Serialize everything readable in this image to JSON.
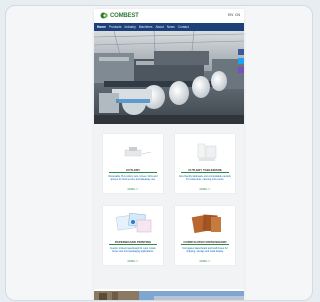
{
  "header": {
    "logo_text": "COMBEST",
    "lang": [
      "EN",
      "CN"
    ]
  },
  "nav": {
    "items": [
      "Home",
      "Products",
      "Industry",
      "Machines",
      "About",
      "News",
      "Contact"
    ]
  },
  "products": [
    {
      "title": "Cutlery",
      "desc": "Disposable PLA cutlery sets, knives, forks and spoons for food service and takeaway use.",
      "more": "MORE >>"
    },
    {
      "title": "Cutlery Tableware",
      "desc": "Eco-friendly tableware and compostable utensils for restaurants, catering and events.",
      "more": "MORE >>"
    },
    {
      "title": "Paperboard Printing",
      "desc": "Custom printed paperboard for cups, bowls, boxes and food packaging applications.",
      "more": "MORE >>"
    },
    {
      "title": "Corrugated Paperboard",
      "desc": "Corrugated paperboard and kraft boxes for shipping, storage and retail display.",
      "more": "MORE >>"
    }
  ],
  "colors": {
    "nav": "#1d3f7a",
    "accent": "#2f8a3a",
    "link": "#0b5fa8"
  }
}
